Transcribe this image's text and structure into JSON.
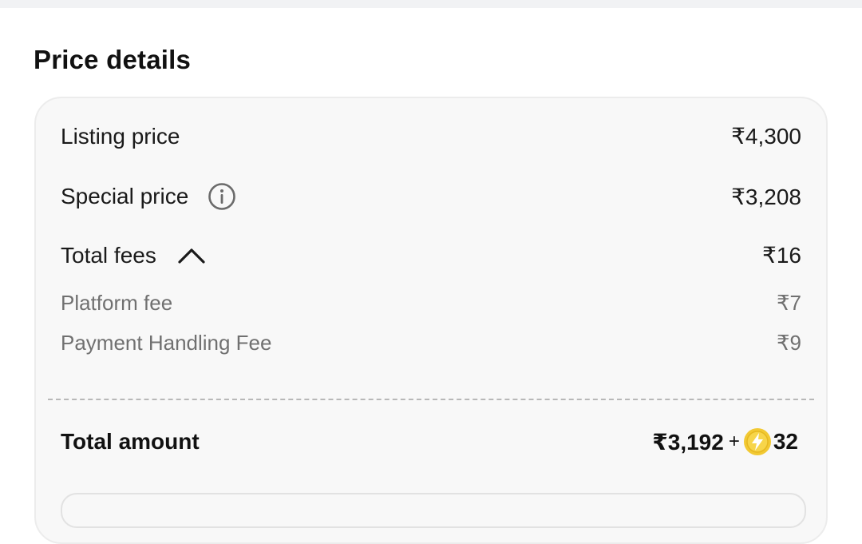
{
  "section": {
    "title": "Price details"
  },
  "rows": {
    "listing": {
      "label": "Listing price",
      "value": "₹4,300"
    },
    "special": {
      "label": "Special price",
      "value": "₹3,208",
      "icon": "info-icon"
    },
    "fees": {
      "label": "Total fees",
      "value": "₹16",
      "icon": "chevron-up-icon",
      "expanded": true
    },
    "platform_fee": {
      "label": "Platform fee",
      "value": "₹7"
    },
    "payment_fee": {
      "label": "Payment Handling Fee",
      "value": "₹9"
    }
  },
  "total": {
    "label": "Total amount",
    "value": "₹3,192",
    "plus": "+",
    "coins": "32",
    "coin_icon": "supercoin-icon"
  },
  "colors": {
    "card_bg": "#f8f8f8",
    "muted_text": "#707070",
    "coin": "#f2c933"
  }
}
